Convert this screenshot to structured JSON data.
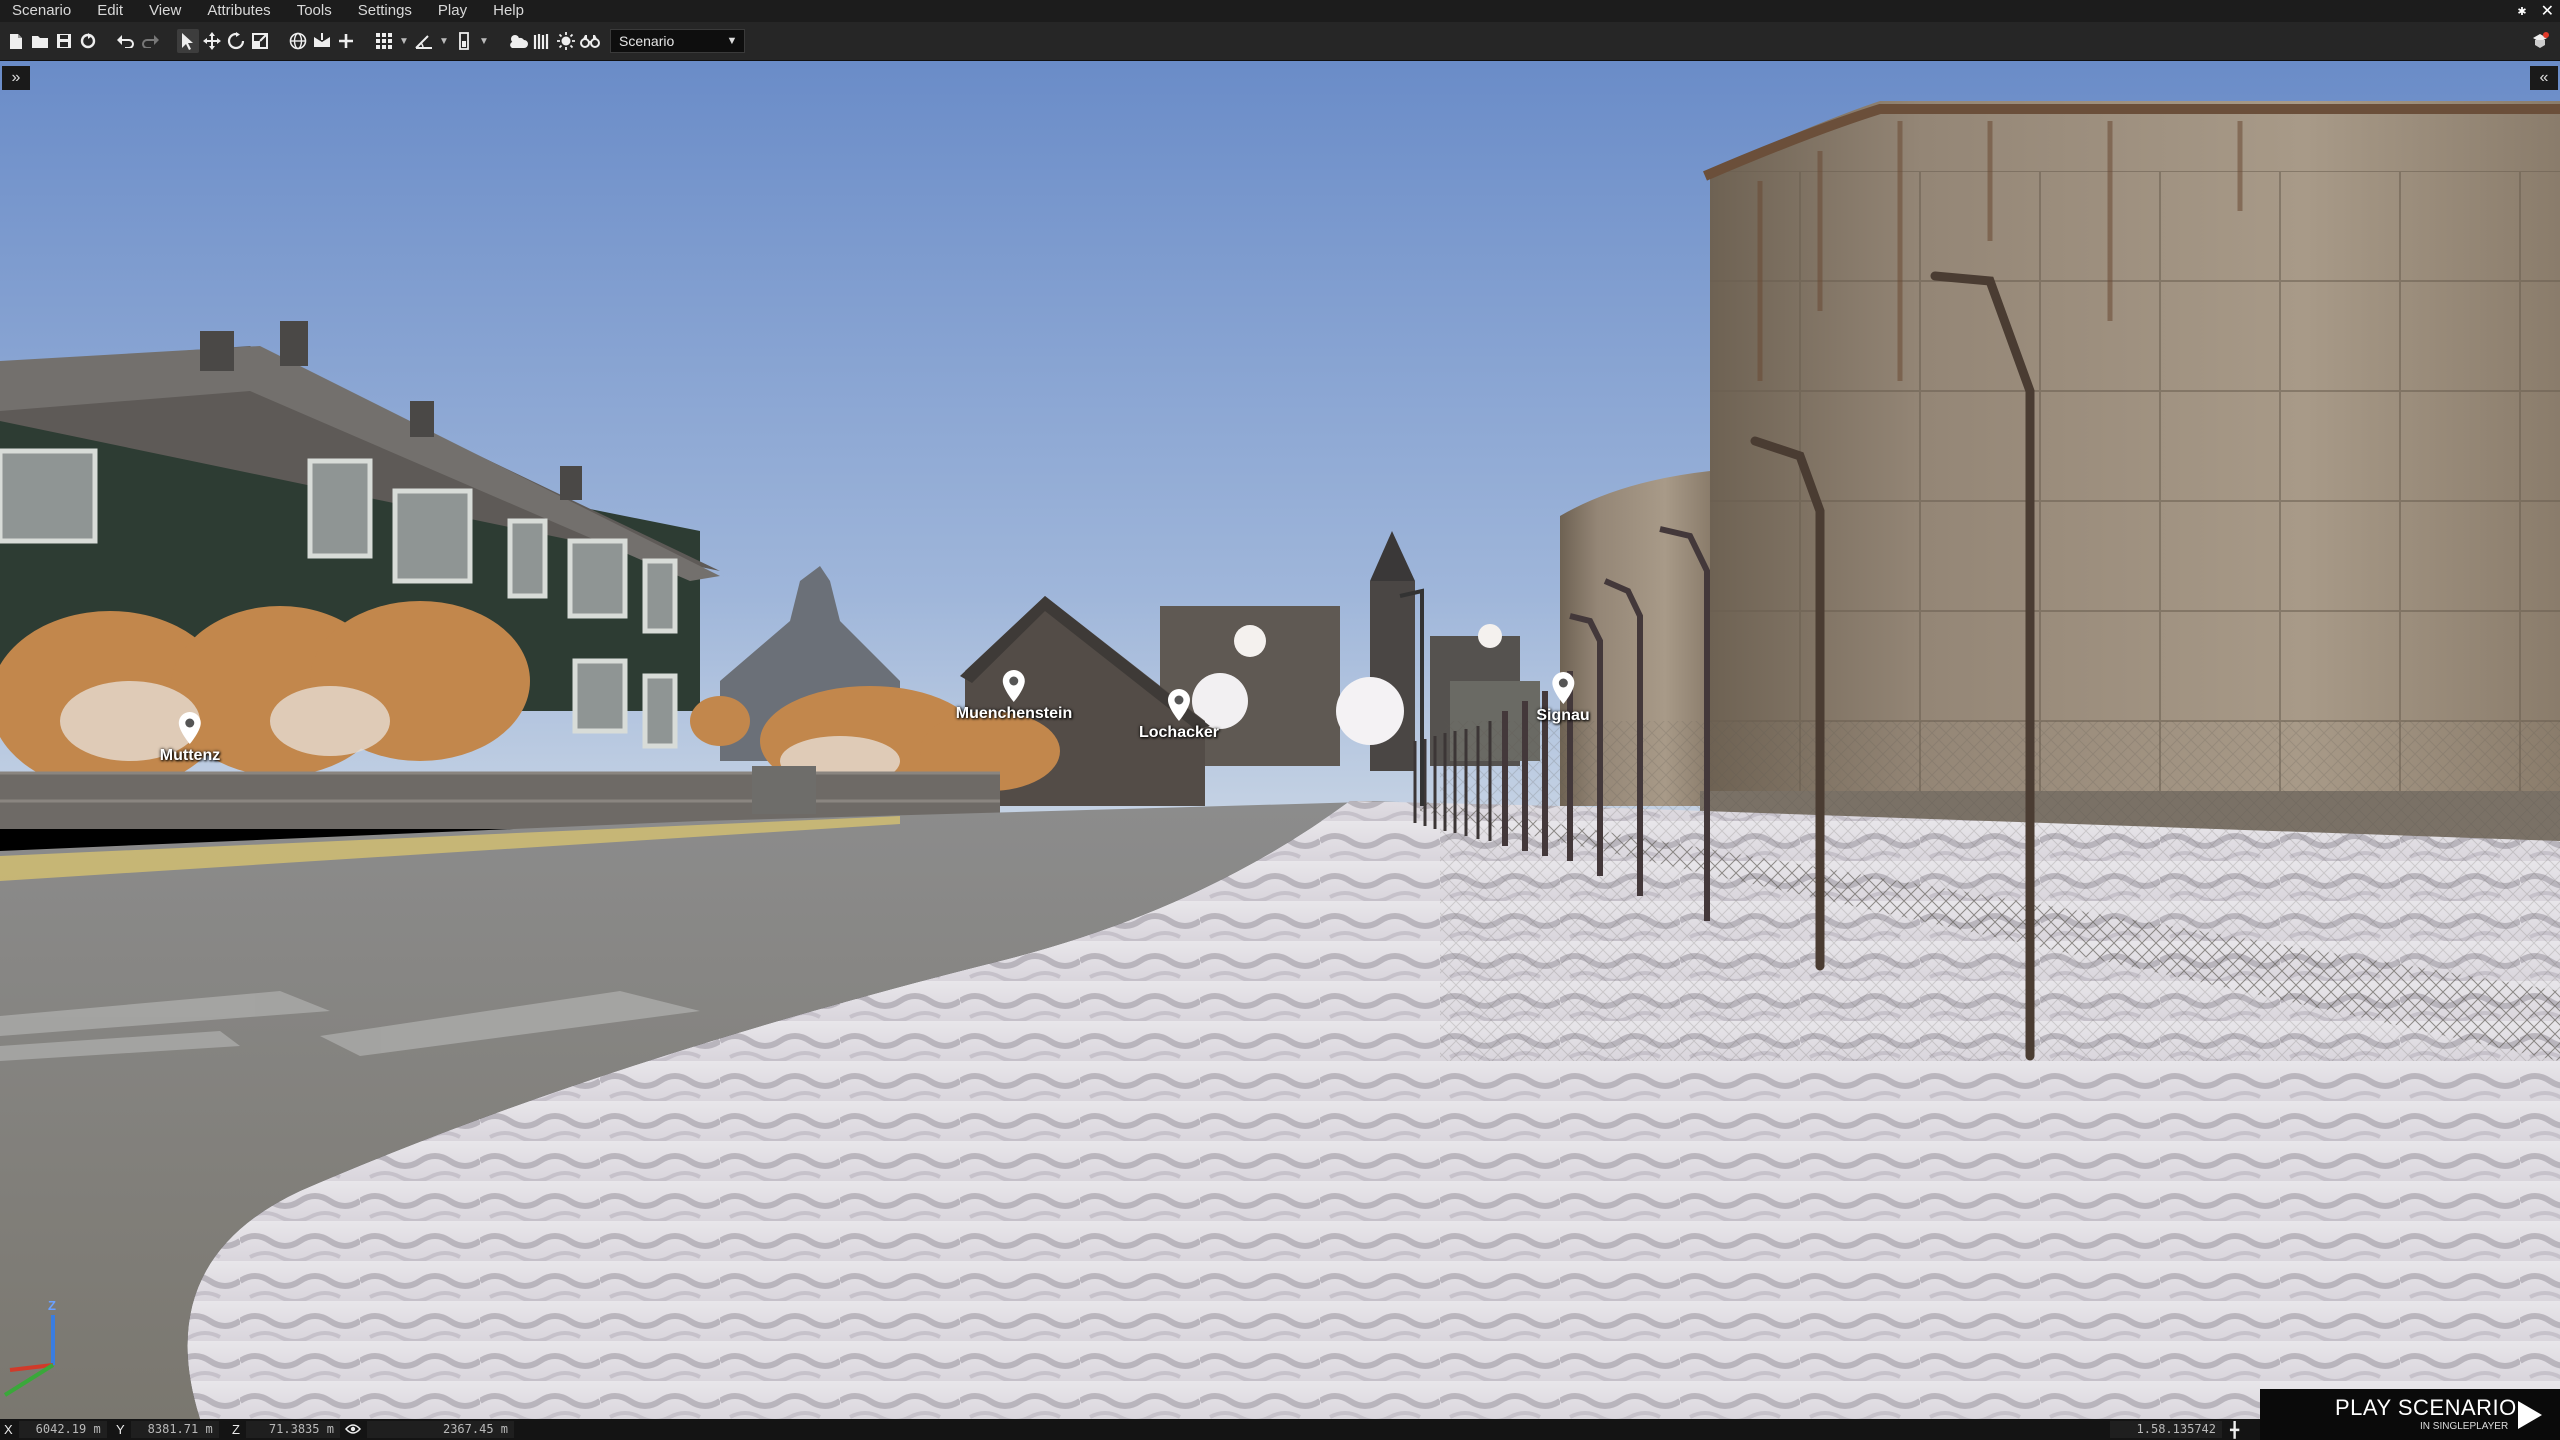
{
  "menu": {
    "items": [
      "Scenario",
      "Edit",
      "View",
      "Attributes",
      "Tools",
      "Settings",
      "Play",
      "Help"
    ]
  },
  "toolbar": {
    "scenario_select_value": "Scenario"
  },
  "markers": [
    {
      "label": "Muttenz"
    },
    {
      "label": "Muenchenstein"
    },
    {
      "label": "Lochacker"
    },
    {
      "label": "Signau"
    }
  ],
  "axis_gizmo": {
    "z_label": "Z"
  },
  "status": {
    "x_label": "X",
    "x_value": "6042.19 m",
    "y_label": "Y",
    "y_value": "8381.71 m",
    "z_label": "Z",
    "z_value": "71.3835 m",
    "view_distance": "2367.45 m",
    "version": "1.58.135742"
  },
  "play": {
    "title": "PLAY SCENARIO",
    "subtitle": "IN SINGLEPLAYER"
  },
  "icons": [
    "new-file-icon",
    "open-folder-icon",
    "save-icon",
    "refresh-icon",
    "undo-icon",
    "redo-icon",
    "select-icon",
    "move-icon",
    "rotate-icon",
    "scale-icon",
    "globe-icon",
    "snap-icon",
    "add-icon",
    "grid-icon",
    "angle-icon",
    "vertical-icon",
    "weather-icon",
    "fog-icon",
    "sun-icon",
    "binoculars-icon"
  ],
  "colors": {
    "menubar": "#1c1c1c",
    "toolbar": "#262626",
    "statusbar": "#141414",
    "sky_top": "#6e8fc9",
    "sky_bottom": "#b3c6de"
  }
}
